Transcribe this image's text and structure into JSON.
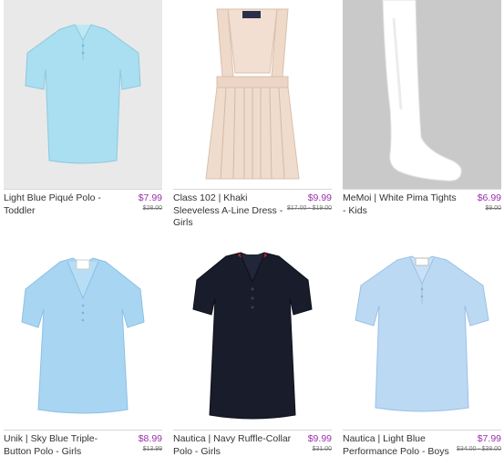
{
  "products": [
    {
      "name": "Light Blue Piqué Polo - Toddler",
      "price": "$7.99",
      "original": "$28.00",
      "image_icon": "light-blue-polo-shirt",
      "bg": "#e8e8e8"
    },
    {
      "name": "Class 102 | Khaki Sleeveless A-Line Dress - Girls",
      "price": "$9.99",
      "original": "$17.00 - $19.00",
      "image_icon": "khaki-jumper-dress",
      "bg": "#ffffff"
    },
    {
      "name": "MeMoi | White Pima Tights - Kids",
      "price": "$6.99",
      "original": "$9.00",
      "image_icon": "white-tights",
      "bg": "#c8c8c8"
    },
    {
      "name": "Unik | Sky Blue Triple-Button Polo - Girls",
      "price": "$8.99",
      "original": "$13.99",
      "image_icon": "sky-blue-girls-polo",
      "bg": "#ffffff"
    },
    {
      "name": "Nautica | Navy Ruffle-Collar Polo - Girls",
      "price": "$9.99",
      "original": "$31.00",
      "image_icon": "navy-ruffle-polo",
      "bg": "#ffffff"
    },
    {
      "name": "Nautica | Light Blue Performance Polo - Boys",
      "price": "$7.99",
      "original": "$34.00 - $38.00",
      "image_icon": "light-blue-performance-polo",
      "bg": "#ffffff"
    }
  ],
  "colors": {
    "price": "#9b2fae",
    "separator": "#d8d8d8"
  }
}
